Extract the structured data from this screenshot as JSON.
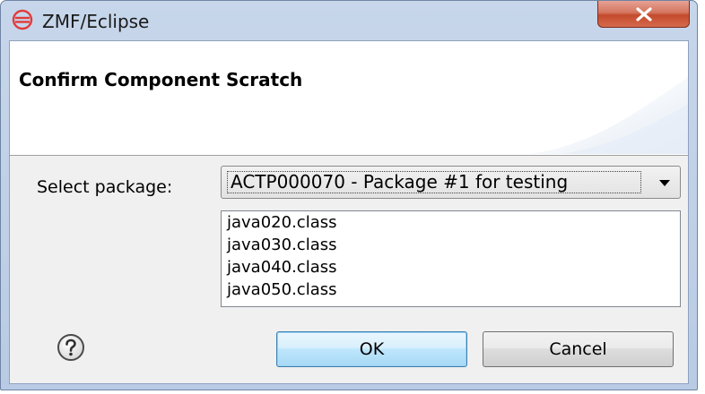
{
  "window": {
    "title": "ZMF/Eclipse",
    "close_glyph": "close-icon"
  },
  "banner": {
    "title": "Confirm Component Scratch"
  },
  "form": {
    "package_label": "Select package:",
    "package_selected": "ACTP000070 - Package #1 for testing",
    "components": [
      "java020.class",
      "java030.class",
      "java040.class",
      "java050.class"
    ]
  },
  "buttons": {
    "ok": "OK",
    "cancel": "Cancel"
  },
  "colors": {
    "titlebar": "#c3d3e8",
    "close_button": "#c9523a",
    "dialog_background": "#f0f0f0",
    "ok_button_border": "#3c7fb1",
    "app_icon": "#e03b3b"
  }
}
